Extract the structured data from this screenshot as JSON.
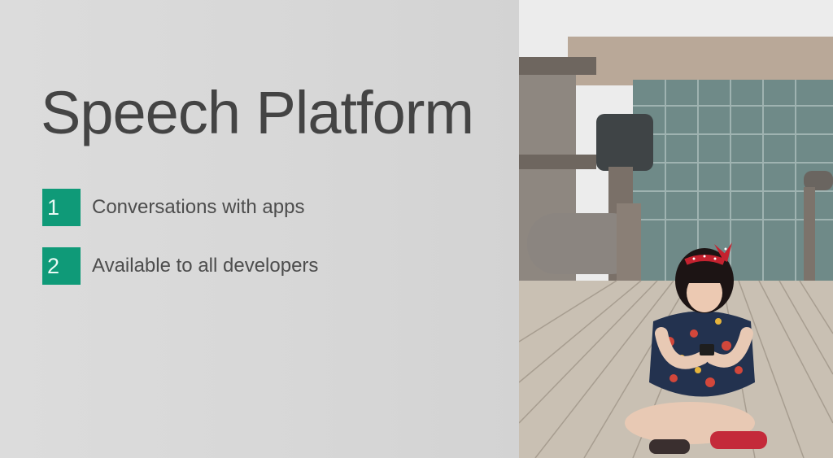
{
  "slide": {
    "title": "Speech Platform",
    "bullets": [
      {
        "number": "1",
        "text": "Conversations with apps"
      },
      {
        "number": "2",
        "text": "Available to all developers"
      }
    ]
  },
  "colors": {
    "accent": "#0f9a78",
    "background": "#d9d9d9",
    "title_text": "#444444"
  },
  "photo": {
    "subject": "girl-sitting-with-phone"
  }
}
